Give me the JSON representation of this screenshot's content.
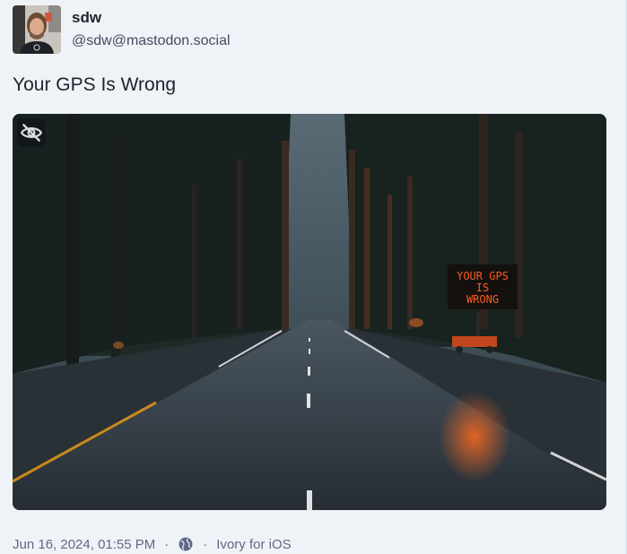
{
  "account": {
    "display_name": "sdw",
    "handle": "@sdw@mastodon.social"
  },
  "status": {
    "text": "Your GPS Is Wrong"
  },
  "media": {
    "sign_lines": [
      "YOUR GPS",
      "IS",
      "WRONG"
    ],
    "hide_icon": "eye-slash-icon"
  },
  "meta": {
    "timestamp": "Jun 16, 2024, 01:55 PM",
    "separator": "·",
    "visibility_icon": "globe-icon",
    "application": "Ivory for iOS"
  },
  "colors": {
    "background": "#eff3f8",
    "text_primary": "#1f232b",
    "text_secondary": "#606984",
    "sign_led": "#ff5a1f"
  }
}
